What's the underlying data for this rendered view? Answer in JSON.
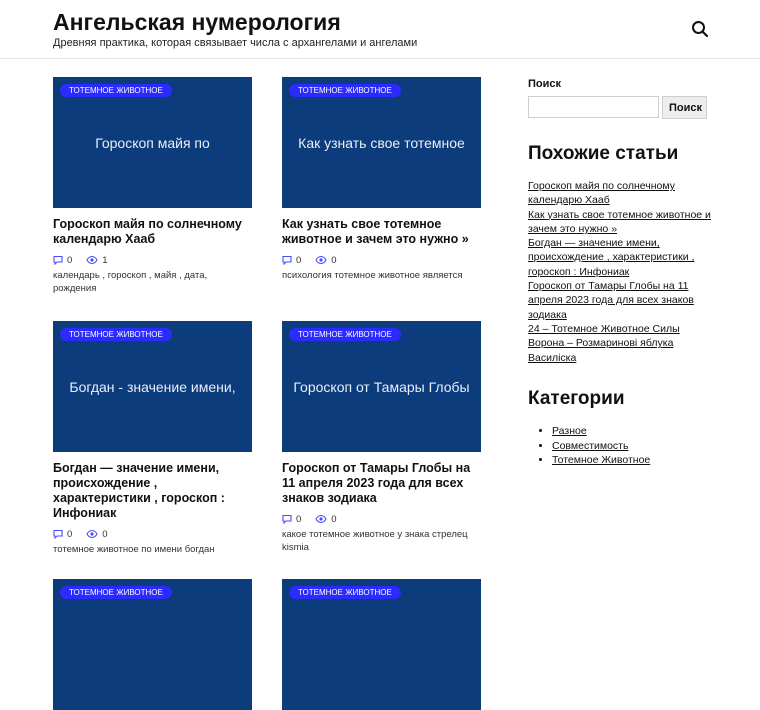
{
  "header": {
    "title": "Ангельская нумерология",
    "description": "Древняя практика, которая связывает числа с архангелами и ангелами",
    "search_icon": "search-icon"
  },
  "posts": [
    {
      "badge": "ТОТЕМНОЕ ЖИВОТНОЕ",
      "thumb_text": "Гороскоп майя по",
      "title": "Гороскоп майя по солнечному календарю Хааб",
      "comments": "0",
      "views": "1",
      "excerpt": "календарь , гороскоп , майя , дата, рождения"
    },
    {
      "badge": "ТОТЕМНОЕ ЖИВОТНОЕ",
      "thumb_text": "Как узнать свое тотемное",
      "title": "Как узнать свое тотемное животное и зачем это нужно »",
      "comments": "0",
      "views": "0",
      "excerpt": "психология тотемное животное является"
    },
    {
      "badge": "ТОТЕМНОЕ ЖИВОТНОЕ",
      "thumb_text": "Богдан - значение имени,",
      "title": "Богдан — значение имени, происхождение , характеристики , гороскоп : Инфониак",
      "comments": "0",
      "views": "0",
      "excerpt": "тотемное животное по имени богдан"
    },
    {
      "badge": "ТОТЕМНОЕ ЖИВОТНОЕ",
      "thumb_text": "Гороскоп от Тамары Глобы",
      "title": "Гороскоп от Тамары Глобы на 11 апреля 2023 года для всех знаков зодиака",
      "comments": "0",
      "views": "0",
      "excerpt": "какое тотемное животное у знака стрелец kismia"
    },
    {
      "badge": "ТОТЕМНОЕ ЖИВОТНОЕ"
    },
    {
      "badge": "ТОТЕМНОЕ ЖИВОТНОЕ"
    }
  ],
  "sidebar": {
    "search_label": "Поиск",
    "search_value": "",
    "search_button": "Поиск",
    "related_title": "Похожие статьи",
    "related": [
      "Гороскоп майя по солнечному календарю Хааб",
      "Как узнать свое тотемное животное и зачем это нужно »",
      "Богдан — значение имени, происхождение , характеристики , гороскоп : Инфониак",
      "Гороскоп от Тамары Глобы на 11 апреля 2023 года для всех знаков зодиака",
      "24 – Тотемное Животное Силы Ворона – Розмаринові яблука Василіска"
    ],
    "categories_title": "Категории",
    "categories": [
      "Разное",
      "Совместимость",
      "Тотемное Животное"
    ]
  },
  "colors": {
    "thumb": "#0d3c7c",
    "badge": "#2b2bff",
    "meta_icon": "#4a4aff"
  }
}
